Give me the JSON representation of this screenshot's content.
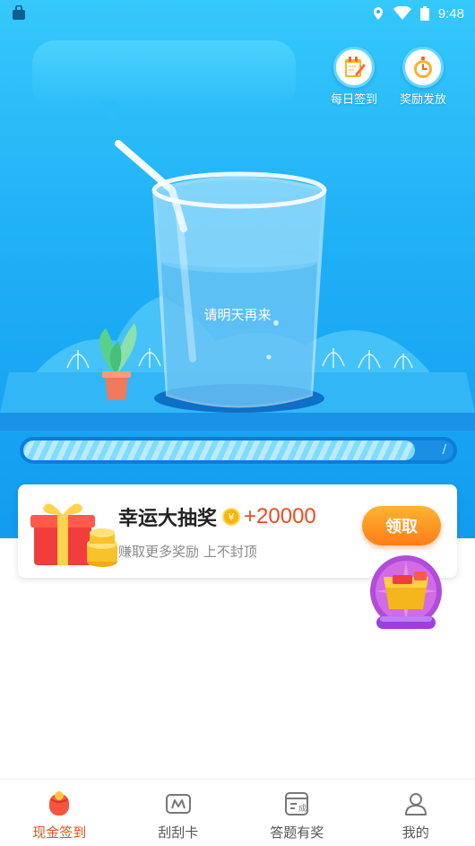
{
  "status_bar": {
    "time": "9:48"
  },
  "top_buttons": {
    "daily_checkin": "每日签到",
    "reward_release": "奖励发放"
  },
  "glass": {
    "message": "请明天再来"
  },
  "progress": {
    "value_fraction": 0.91,
    "end_label": "/"
  },
  "lottery": {
    "title": "幸运大抽奖",
    "coin_symbol": "¥",
    "amount": "+20000",
    "subtitle": "赚取更多奖励 上不封顶",
    "claim_label": "领取"
  },
  "tabs": [
    {
      "label": "现金签到",
      "icon": "red-envelope-icon",
      "active": true
    },
    {
      "label": "刮刮卡",
      "icon": "scratch-card-icon",
      "active": false
    },
    {
      "label": "答题有奖",
      "icon": "quiz-icon",
      "active": false
    },
    {
      "label": "我的",
      "icon": "user-icon",
      "active": false
    }
  ],
  "colors": {
    "accent": "#e8501f",
    "sky": "#1fb0f6",
    "claim": "#ff8c1f"
  }
}
